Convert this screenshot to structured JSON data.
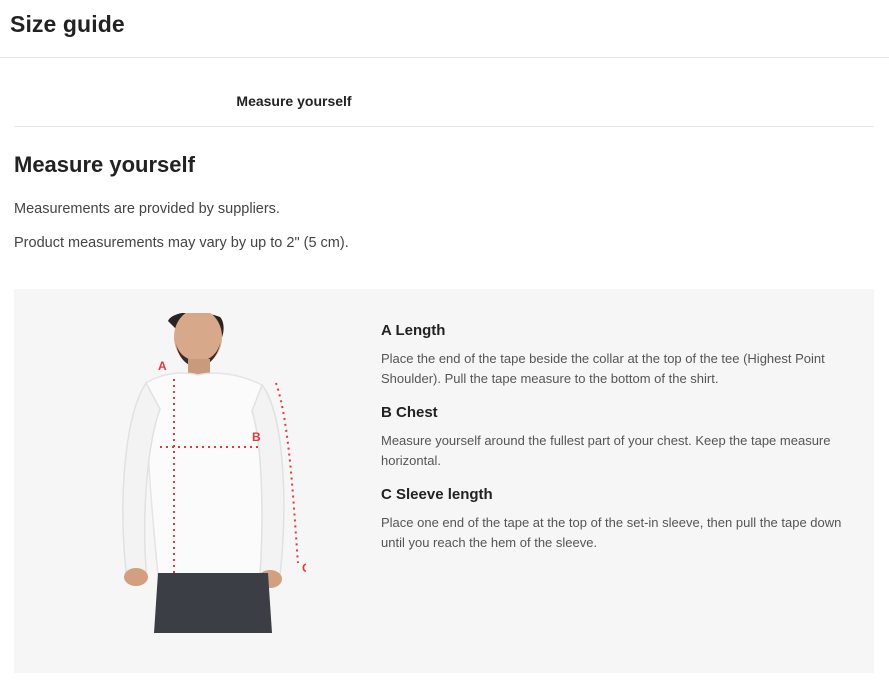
{
  "header": {
    "title": "Size guide"
  },
  "tabs": [
    {
      "label": "Measure yourself",
      "active": true
    }
  ],
  "section": {
    "title": "Measure yourself",
    "paragraphs": [
      "Measurements are provided by suppliers.",
      "Product measurements may vary by up to 2\" (5 cm)."
    ]
  },
  "figure": {
    "labels": {
      "a": "A",
      "b": "B",
      "c": "C"
    },
    "marker_color": "#e0393e"
  },
  "measurements": [
    {
      "title": "A Length",
      "text": "Place the end of the tape beside the collar at the top of the tee (Highest Point Shoulder). Pull the tape measure to the bottom of the shirt."
    },
    {
      "title": "B Chest",
      "text": "Measure yourself around the fullest part of your chest. Keep the tape measure horizontal."
    },
    {
      "title": "C Sleeve length",
      "text": "Place one end of the tape at the top of the set-in sleeve, then pull the tape down until you reach the hem of the sleeve."
    }
  ]
}
